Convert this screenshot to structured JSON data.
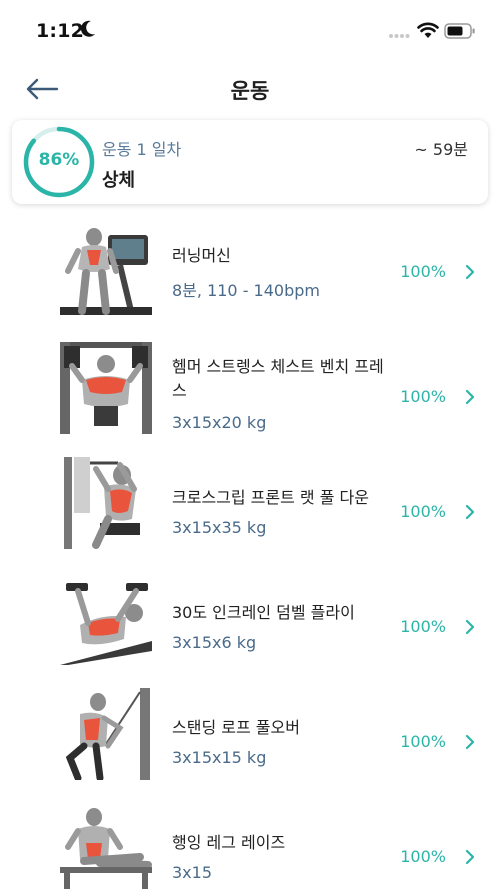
{
  "status_bar": {
    "time": "1:12",
    "icons": [
      "moon-icon",
      "cellular-dots-icon",
      "wifi-icon",
      "battery-icon"
    ]
  },
  "header": {
    "title": "운동",
    "back_icon": "arrow-left-icon"
  },
  "summary": {
    "progress_label": "86%",
    "progress_value": 0.86,
    "day_label": "운동 1 일차",
    "workout_name": "상체",
    "duration": "~ 59분"
  },
  "exercises": [
    {
      "name": "러닝머신",
      "detail": "8분, 110 - 140bpm",
      "completion": "100%"
    },
    {
      "name": "헴머 스트렝스 체스트 벤치 프레스",
      "detail": "3x15x20 kg",
      "completion": "100%"
    },
    {
      "name": "크로스그립 프론트 랫 풀 다운",
      "detail": "3x15x35 kg",
      "completion": "100%"
    },
    {
      "name": "30도 인크레인 덤벨 플라이",
      "detail": "3x15x6 kg",
      "completion": "100%"
    },
    {
      "name": "스탠딩 로프 풀오버",
      "detail": "3x15x15 kg",
      "completion": "100%"
    },
    {
      "name": "행잉 레그 레이즈",
      "detail": "3x15",
      "completion": "100%"
    }
  ],
  "colors": {
    "accent": "#2bb5a8",
    "detail_text": "#4a6a8a",
    "muscle_highlight": "#e8553c"
  }
}
